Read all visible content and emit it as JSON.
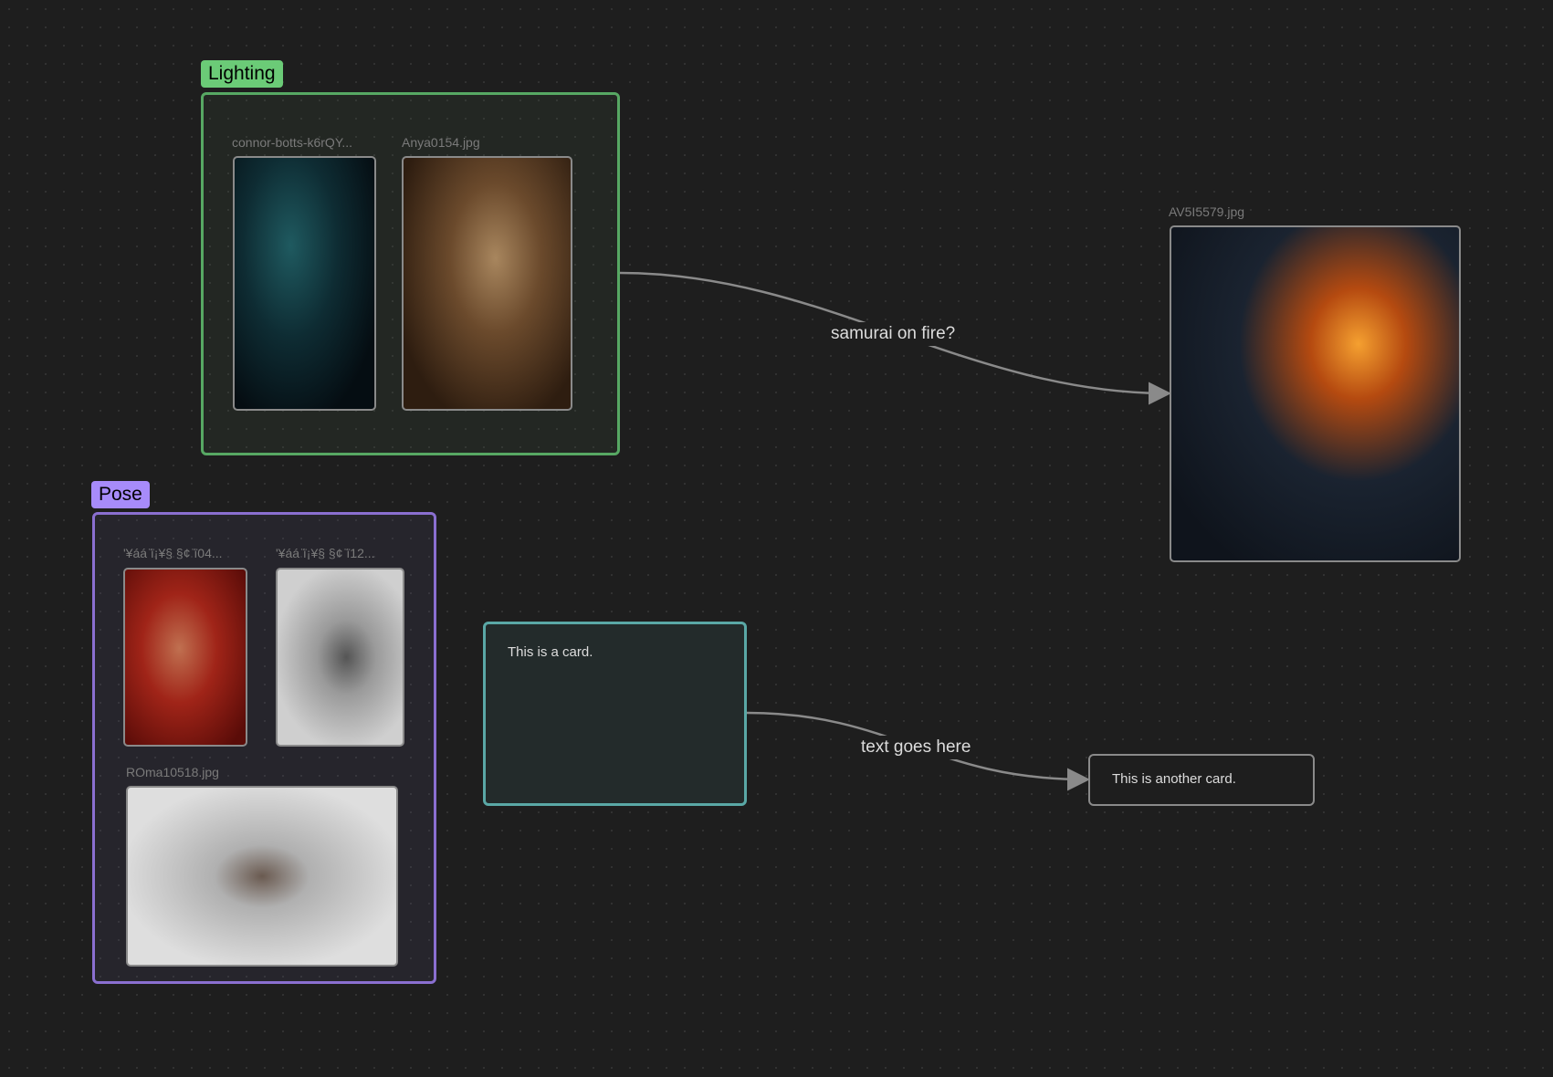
{
  "groups": {
    "lighting": {
      "label": "Lighting",
      "color": "#6bcb77"
    },
    "pose": {
      "label": "Pose",
      "color": "#a78bfa"
    }
  },
  "files": {
    "connor": "connor-botts-k6rQY...",
    "anya": "Anya0154.jpg",
    "samurai": "AV5I5579.jpg",
    "pose1": "'¥áá ̈ï¡¥§ §¢ ̈ï04...",
    "pose2": "'¥áá ̈ï¡¥§ §¢ ̈ï12...",
    "roma": "ROma10518.jpg"
  },
  "cards": {
    "card1": "This is a card.",
    "card2": "This is another card."
  },
  "edges": {
    "edge1": "samurai on fire?",
    "edge2": "text goes here"
  }
}
